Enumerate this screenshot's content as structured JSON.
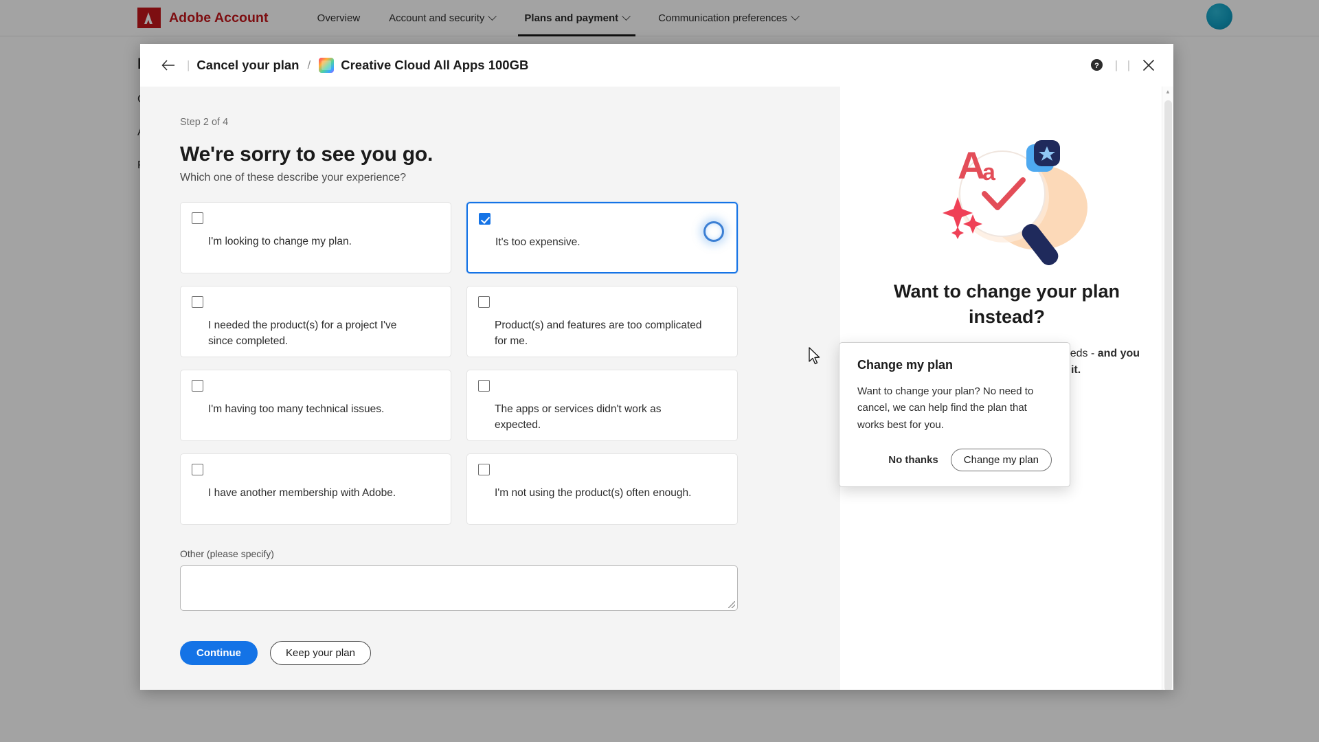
{
  "topnav": {
    "brand": "Adobe Account",
    "items": [
      {
        "label": "Overview",
        "has_caret": false,
        "active": false
      },
      {
        "label": "Account and security",
        "has_caret": true,
        "active": false
      },
      {
        "label": "Plans and payment",
        "has_caret": true,
        "active": true
      },
      {
        "label": "Communication preferences",
        "has_caret": true,
        "active": false
      }
    ],
    "avatar": "user-avatar"
  },
  "background": {
    "line1": "P",
    "line2": "C",
    "line3": "A",
    "line4": "P"
  },
  "dialog": {
    "back_icon": "back-arrow-icon",
    "separator": "|",
    "title": "Cancel your plan",
    "slash": "/",
    "product_icon": "creative-cloud-icon",
    "product": "Creative Cloud All Apps 100GB",
    "help_icon": "help-circle-icon",
    "vbar1": "|",
    "vbar2": "|",
    "close_icon": "close-icon"
  },
  "left": {
    "step": "Step 2 of 4",
    "headline": "We're sorry to see you go.",
    "subhead": "Which one of these describe your experience?",
    "options": [
      {
        "label": "I'm looking to change my plan.",
        "checked": false,
        "selected": false
      },
      {
        "label": "It's too expensive.",
        "checked": true,
        "selected": true
      },
      {
        "label": "I needed the product(s) for a project I've since completed.",
        "checked": false,
        "selected": false
      },
      {
        "label": "Product(s) and features are too complicated for me.",
        "checked": false,
        "selected": false
      },
      {
        "label": "I'm having too many technical issues.",
        "checked": false,
        "selected": false
      },
      {
        "label": "The apps or services didn't work as expected.",
        "checked": false,
        "selected": false
      },
      {
        "label": "I have another membership with Adobe.",
        "checked": false,
        "selected": false
      },
      {
        "label": "I'm not using the product(s) often enough.",
        "checked": false,
        "selected": false
      }
    ],
    "other_label": "Other (please specify)",
    "other_value": "",
    "other_placeholder": "",
    "continue_label": "Continue",
    "keep_label": "Keep your plan"
  },
  "right": {
    "illustration": "magnifying-glass-illustration",
    "title": "Want to change your plan instead?",
    "text_part1": "You can switch to a plan that fits your needs - ",
    "text_part2": "and you don't have to cancel to do it.",
    "button_label": "Change my plan"
  },
  "popover": {
    "title": "Change my plan",
    "text": "Want to change your plan? No need to cancel, we can help find the plan that works best for you.",
    "secondary_label": "No thanks",
    "primary_label": "Change my plan"
  },
  "scrollbar": {
    "up_icon": "scroll-up-arrow-icon",
    "down_icon": "scroll-down-arrow-icon"
  },
  "colors": {
    "adobe_red": "#c4161c",
    "accent_blue": "#1473e6",
    "page_bg": "#f4f4f4"
  }
}
